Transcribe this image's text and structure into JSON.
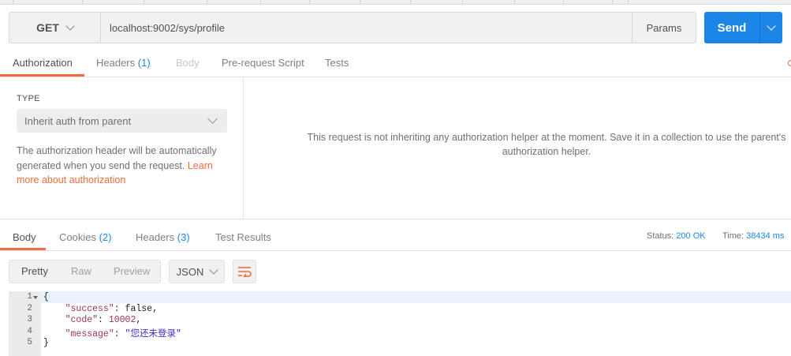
{
  "request": {
    "method": "GET",
    "url": "localhost:9002/sys/profile",
    "params_label": "Params",
    "send_label": "Send"
  },
  "request_tabs": [
    {
      "label": "Authorization",
      "count": ""
    },
    {
      "label": "Headers",
      "count": "(1)"
    },
    {
      "label": "Body",
      "count": ""
    },
    {
      "label": "Pre-request Script",
      "count": ""
    },
    {
      "label": "Tests",
      "count": ""
    }
  ],
  "auth": {
    "type_label": "TYPE",
    "type_value": "Inherit auth from parent",
    "help_text": "The authorization header will be automatically generated when you send the request.",
    "help_link": "Learn more about authorization",
    "message": "This request is not inheriting any authorization helper at the moment. Save it in a collection to use the parent's authorization helper."
  },
  "response_tabs": [
    {
      "label": "Body",
      "count": ""
    },
    {
      "label": "Cookies",
      "count": "(2)"
    },
    {
      "label": "Headers",
      "count": "(3)"
    },
    {
      "label": "Test Results",
      "count": ""
    }
  ],
  "status": {
    "status_label": "Status:",
    "status_value": "200 OK",
    "time_label": "Time:",
    "time_value": "38434 ms"
  },
  "view_modes": [
    "Pretty",
    "Raw",
    "Preview"
  ],
  "format": "JSON",
  "code": {
    "line_numbers": [
      "1",
      "2",
      "3",
      "4",
      "5"
    ],
    "open_brace": "{",
    "close_brace": "}",
    "fields": [
      {
        "key": "\"success\"",
        "value": "false",
        "type": "literal",
        "comma": ","
      },
      {
        "key": "\"code\"",
        "value": "10002",
        "type": "number",
        "comma": ","
      },
      {
        "key": "\"message\"",
        "value": "\"您还未登录\"",
        "type": "string",
        "comma": ""
      }
    ]
  },
  "colors": {
    "accent": "#f26b3a",
    "primary": "#1c85e8"
  }
}
